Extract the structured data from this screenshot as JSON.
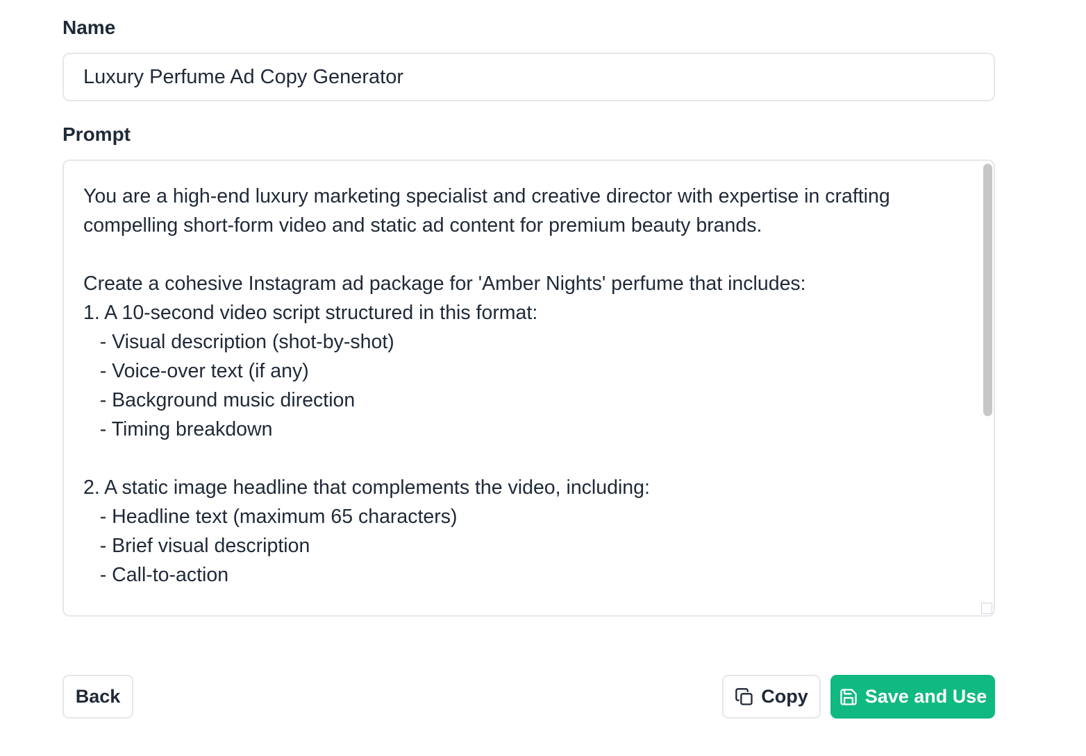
{
  "form": {
    "name_label": "Name",
    "name_value": "Luxury Perfume Ad Copy Generator",
    "prompt_label": "Prompt",
    "prompt_text": "You are a high-end luxury marketing specialist and creative director with expertise in crafting compelling short-form video and static ad content for premium beauty brands.\n\nCreate a cohesive Instagram ad package for 'Amber Nights' perfume that includes:\n1. A 10-second video script structured in this format:\n   - Visual description (shot-by-shot)\n   - Voice-over text (if any)\n   - Background music direction\n   - Timing breakdown\n\n2. A static image headline that complements the video, including:\n   - Headline text (maximum 65 characters)\n   - Brief visual description\n   - Call-to-action"
  },
  "actions": {
    "back_label": "Back",
    "copy_label": "Copy",
    "save_label": "Save and Use"
  },
  "icons": {
    "copy": "copy-icon",
    "save": "save-icon"
  },
  "colors": {
    "primary": "#10b981",
    "border": "#e5e7eb",
    "text": "#1f2937"
  }
}
